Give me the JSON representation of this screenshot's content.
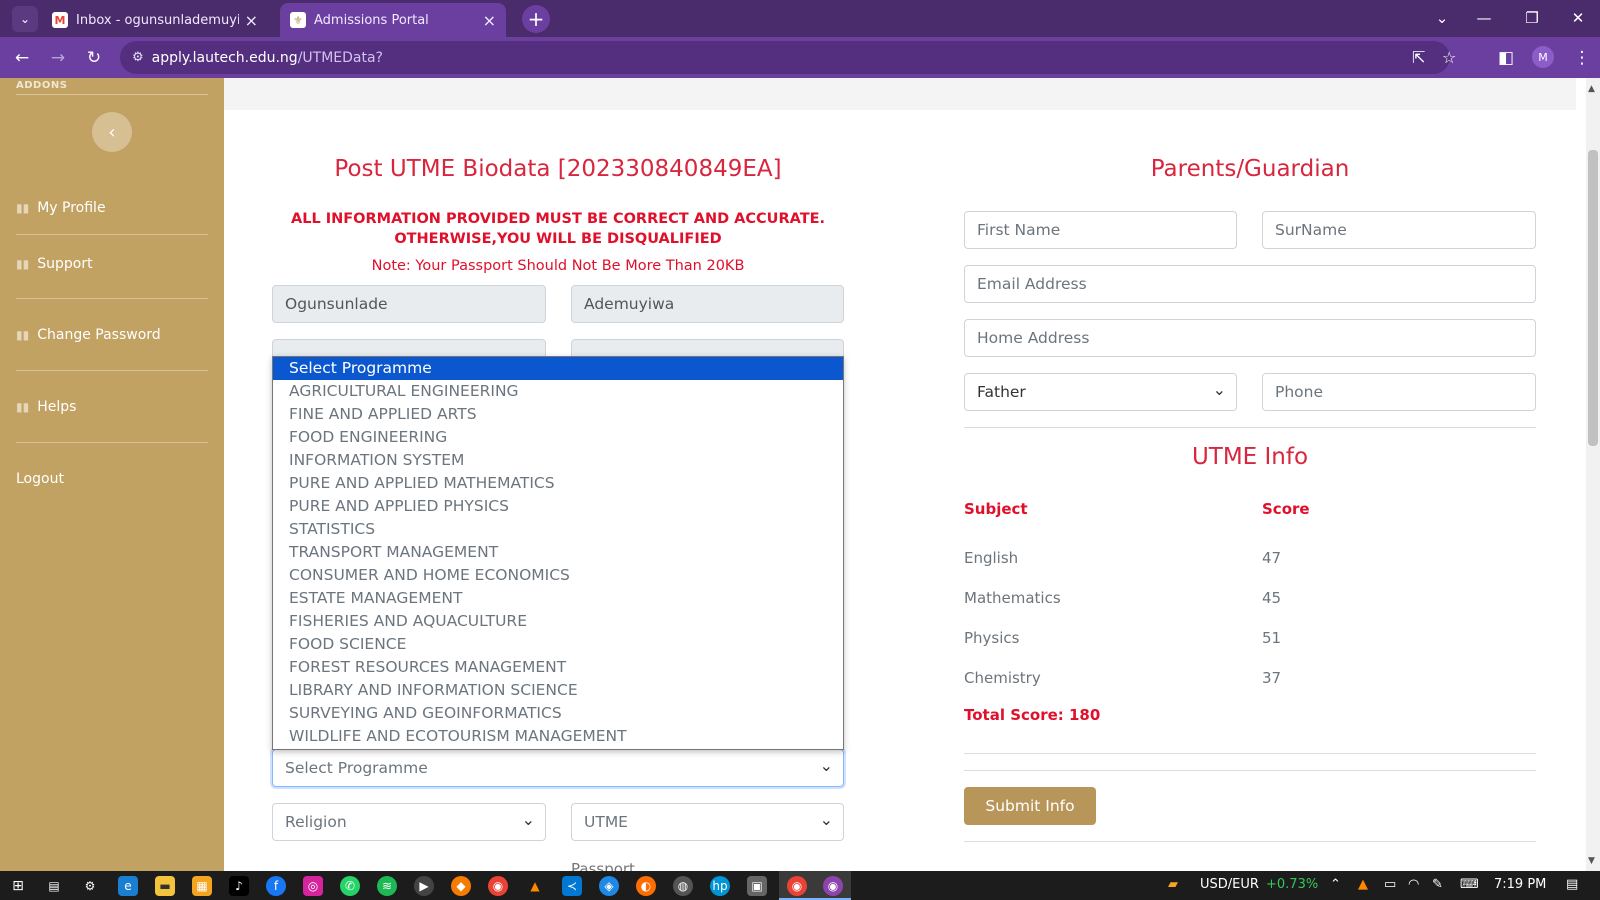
{
  "browser": {
    "tabs": [
      {
        "label": "Inbox - ogunsunlademuyiwa98@",
        "favicon": "M",
        "active": false
      },
      {
        "label": "Admissions Portal",
        "favicon": "⚜",
        "active": true
      }
    ],
    "url_domain": "apply.lautech.edu.ng",
    "url_path": "/UTMEData?",
    "profile_initial": "M"
  },
  "sidebar": {
    "section_label": "ADDONS",
    "collapse_icon": "‹",
    "items": [
      {
        "label": "My Profile",
        "icon": "chart-icon"
      },
      {
        "label": "Support",
        "icon": "chart-icon"
      },
      {
        "label": "Change Password",
        "icon": "chart-icon"
      },
      {
        "label": "Helps",
        "icon": "chart-icon"
      },
      {
        "label": "Logout",
        "icon": ""
      }
    ]
  },
  "biodata": {
    "title": "Post UTME Biodata [202330840849EA]",
    "warning_line1": "ALL INFORMATION PROVIDED MUST BE CORRECT AND ACCURATE.",
    "warning_line2": "OTHERWISE,YOU WILL BE DISQUALIFIED",
    "note": "Note: Your Passport Should Not Be More Than 20KB",
    "surname": "Ogunsunlade",
    "firstname": "Ademuyiwa",
    "programme_selected": "Select Programme",
    "religion_selected": "Religion",
    "exam_selected": "UTME",
    "passport_label": "Passport",
    "programme_options": [
      "Select Programme",
      "AGRICULTURAL ENGINEERING",
      "FINE AND APPLIED ARTS",
      "FOOD ENGINEERING",
      "INFORMATION SYSTEM",
      "PURE AND APPLIED MATHEMATICS",
      "PURE AND APPLIED PHYSICS",
      "STATISTICS",
      "TRANSPORT MANAGEMENT",
      "CONSUMER AND HOME ECONOMICS",
      "ESTATE MANAGEMENT",
      "FISHERIES AND AQUACULTURE",
      "FOOD SCIENCE",
      "FOREST RESOURCES MANAGEMENT",
      "LIBRARY AND INFORMATION SCIENCE",
      "SURVEYING AND GEOINFORMATICS",
      "WILDLIFE AND ECOTOURISM MANAGEMENT"
    ]
  },
  "guardian": {
    "title": "Parents/Guardian",
    "first_name_placeholder": "First Name",
    "surname_placeholder": "SurName",
    "email_placeholder": "Email Address",
    "address_placeholder": "Home Address",
    "relation_selected": "Father",
    "phone_placeholder": "Phone"
  },
  "utme": {
    "title": "UTME Info",
    "col_subject": "Subject",
    "col_score": "Score",
    "rows": [
      {
        "subject": "English",
        "score": "47"
      },
      {
        "subject": "Mathematics",
        "score": "45"
      },
      {
        "subject": "Physics",
        "score": "51"
      },
      {
        "subject": "Chemistry",
        "score": "37"
      }
    ],
    "total": "Total Score: 180",
    "submit_label": "Submit Info"
  },
  "taskbar": {
    "ticker": "USD/EUR",
    "ticker_change": "+0.73%",
    "time": "7:19 PM"
  }
}
